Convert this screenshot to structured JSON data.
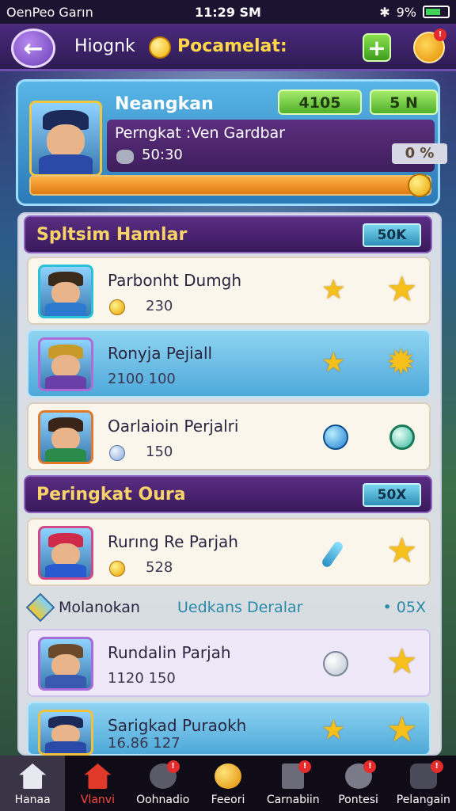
{
  "status_bar": {
    "carrier": "OenPeo Garın",
    "time": "11:29 SM",
    "battery": "9%"
  },
  "top_bar": {
    "title": "Hiognk",
    "currency_label": "Pocamelat:",
    "add_label": "+",
    "badge_count": "!"
  },
  "player": {
    "name": "Neangkan",
    "stat_primary": "4105",
    "stat_secondary": "5 N",
    "rank_text": "Perngkat :Ven Gardbar",
    "score": "50:30",
    "percent_label": "0 %",
    "progress": 0.96
  },
  "sections": [
    {
      "title": "Spltsim Hamlar",
      "badge": "50K"
    },
    {
      "title": "Peringkat Oura",
      "badge": "50X"
    }
  ],
  "rows": [
    {
      "name": "Parbonht Dumgh",
      "score": "230"
    },
    {
      "name": "Ronyja Pejiall",
      "score": "2100 100"
    },
    {
      "name": "Oarlaioin Perjalri",
      "score": "150"
    },
    {
      "name": "Rurıng Re Parjah",
      "score": "528"
    },
    {
      "name": "Rundalin Parjah",
      "score": "1120 150"
    },
    {
      "name": "Sarigkad Puraokh",
      "score": "16.86 127"
    }
  ],
  "subheader": {
    "left": "Molanokan",
    "middle": "Uedkans Deralar",
    "right": "• 05X"
  },
  "bottom_nav": [
    {
      "label": "Hanaa",
      "icon": "home-icon"
    },
    {
      "label": "Vlanvi",
      "icon": "house-red-icon"
    },
    {
      "label": "Oohnadio",
      "icon": "chart-icon"
    },
    {
      "label": "Feeori",
      "icon": "coin-icon"
    },
    {
      "label": "Carnabiin",
      "icon": "document-icon"
    },
    {
      "label": "Pontesi",
      "icon": "gear-icon"
    },
    {
      "label": "Pelangain",
      "icon": "settings-icon"
    }
  ],
  "colors": {
    "accent_purple": "#4b2b7d",
    "gold": "#f5c01c",
    "green_pill": "#4fb12a",
    "blue_row": "#4ea9d9"
  }
}
